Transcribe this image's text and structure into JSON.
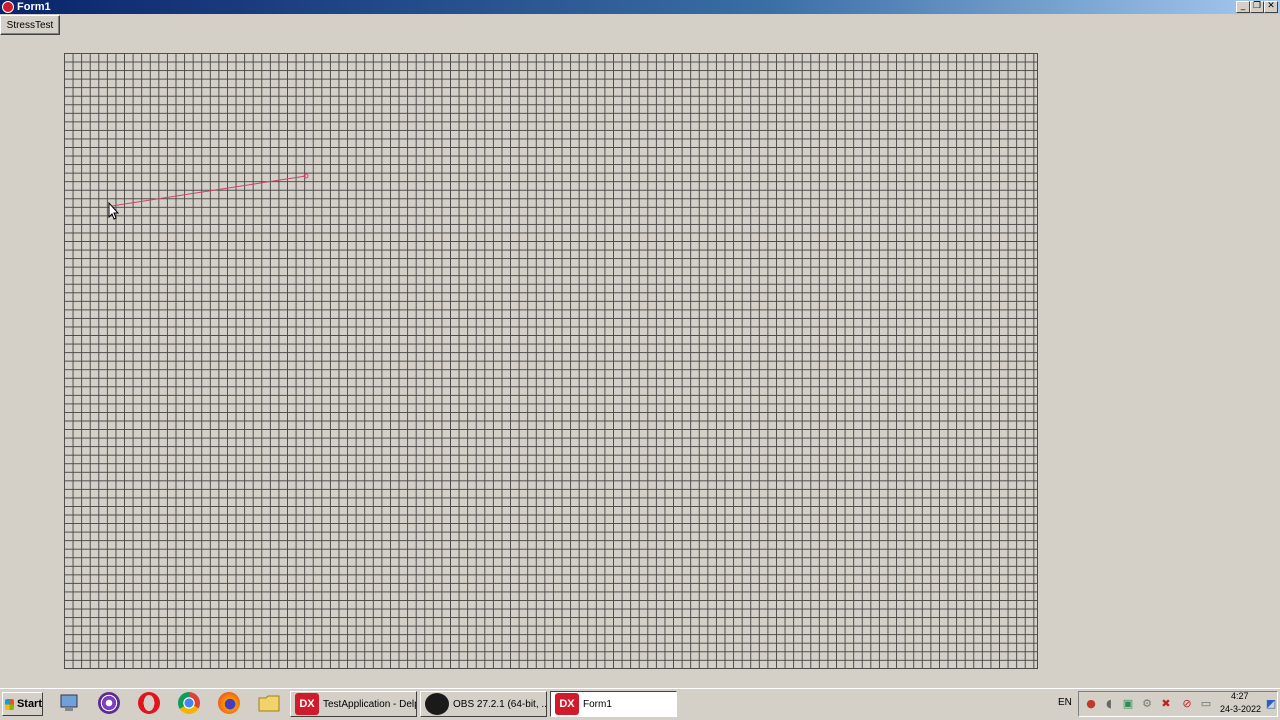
{
  "window": {
    "title": "Form1",
    "minimize": "_",
    "restore": "❐",
    "close": "✕"
  },
  "form": {
    "stress_button_label": "StressTest"
  },
  "taskbar": {
    "start_label": "Start",
    "tasks": [
      {
        "label": "TestApplication - Delp...",
        "icon_text": "DX"
      },
      {
        "label": "OBS 27.2.1 (64-bit, ...",
        "icon_text": ""
      },
      {
        "label": "Form1",
        "icon_text": "DX"
      }
    ],
    "language": "EN",
    "time": "4:27",
    "date": "24-3-2022"
  },
  "colors": {
    "line": "#c8456a",
    "grid": "#4a4a4a",
    "accent_dx": "#d11a2a"
  }
}
